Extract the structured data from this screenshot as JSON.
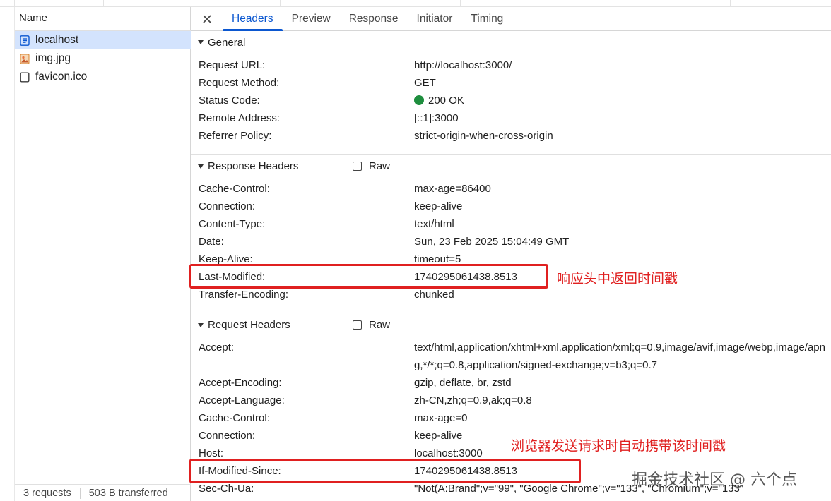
{
  "left_panel": {
    "column_header": "Name",
    "requests": [
      {
        "name": "localhost",
        "icon": "document-icon",
        "selected": true
      },
      {
        "name": "img.jpg",
        "icon": "image-file-icon",
        "selected": false
      },
      {
        "name": "favicon.ico",
        "icon": "empty-file-icon",
        "selected": false
      }
    ],
    "footer": {
      "requests": "3 requests",
      "transferred": "503 B transferred"
    }
  },
  "tabs": {
    "close_icon": "close-icon",
    "items": [
      "Headers",
      "Preview",
      "Response",
      "Initiator",
      "Timing"
    ],
    "active": "Headers"
  },
  "general": {
    "title": "General",
    "rows": [
      {
        "key": "Request URL:",
        "value": "http://localhost:3000/"
      },
      {
        "key": "Request Method:",
        "value": "GET"
      },
      {
        "key": "Status Code:",
        "value": "200 OK",
        "status_color": "#1e8e3e"
      },
      {
        "key": "Remote Address:",
        "value": "[::1]:3000"
      },
      {
        "key": "Referrer Policy:",
        "value": "strict-origin-when-cross-origin"
      }
    ]
  },
  "response_headers": {
    "title": "Response Headers",
    "raw_label": "Raw",
    "rows": [
      {
        "key": "Cache-Control:",
        "value": "max-age=86400"
      },
      {
        "key": "Connection:",
        "value": "keep-alive"
      },
      {
        "key": "Content-Type:",
        "value": "text/html"
      },
      {
        "key": "Date:",
        "value": "Sun, 23 Feb 2025 15:04:49 GMT"
      },
      {
        "key": "Keep-Alive:",
        "value": "timeout=5"
      },
      {
        "key": "Last-Modified:",
        "value": "1740295061438.8513"
      },
      {
        "key": "Transfer-Encoding:",
        "value": "chunked"
      }
    ]
  },
  "request_headers": {
    "title": "Request Headers",
    "raw_label": "Raw",
    "rows": [
      {
        "key": "Accept:",
        "value": "text/html,application/xhtml+xml,application/xml;q=0.9,image/avif,image/webp,image/apng,*/*;q=0.8,application/signed-exchange;v=b3;q=0.7"
      },
      {
        "key": "Accept-Encoding:",
        "value": "gzip, deflate, br, zstd"
      },
      {
        "key": "Accept-Language:",
        "value": "zh-CN,zh;q=0.9,ak;q=0.8"
      },
      {
        "key": "Cache-Control:",
        "value": "max-age=0"
      },
      {
        "key": "Connection:",
        "value": "keep-alive"
      },
      {
        "key": "Host:",
        "value": "localhost:3000"
      },
      {
        "key": "If-Modified-Since:",
        "value": "1740295061438.8513"
      },
      {
        "key": "Sec-Ch-Ua:",
        "value": "\"Not(A:Brand\";v=\"99\", \"Google Chrome\";v=\"133\", \"Chromium\";v=\"133\""
      }
    ]
  },
  "annotations": {
    "response_note": "响应头中返回时间戳",
    "request_note": "浏览器发送请求时自动携带该时间戳",
    "color": "#e02020"
  },
  "watermark": "掘金技术社区 @ 六个点",
  "colors": {
    "accent": "#0b57d0",
    "selected_row": "#d3e3fd"
  }
}
